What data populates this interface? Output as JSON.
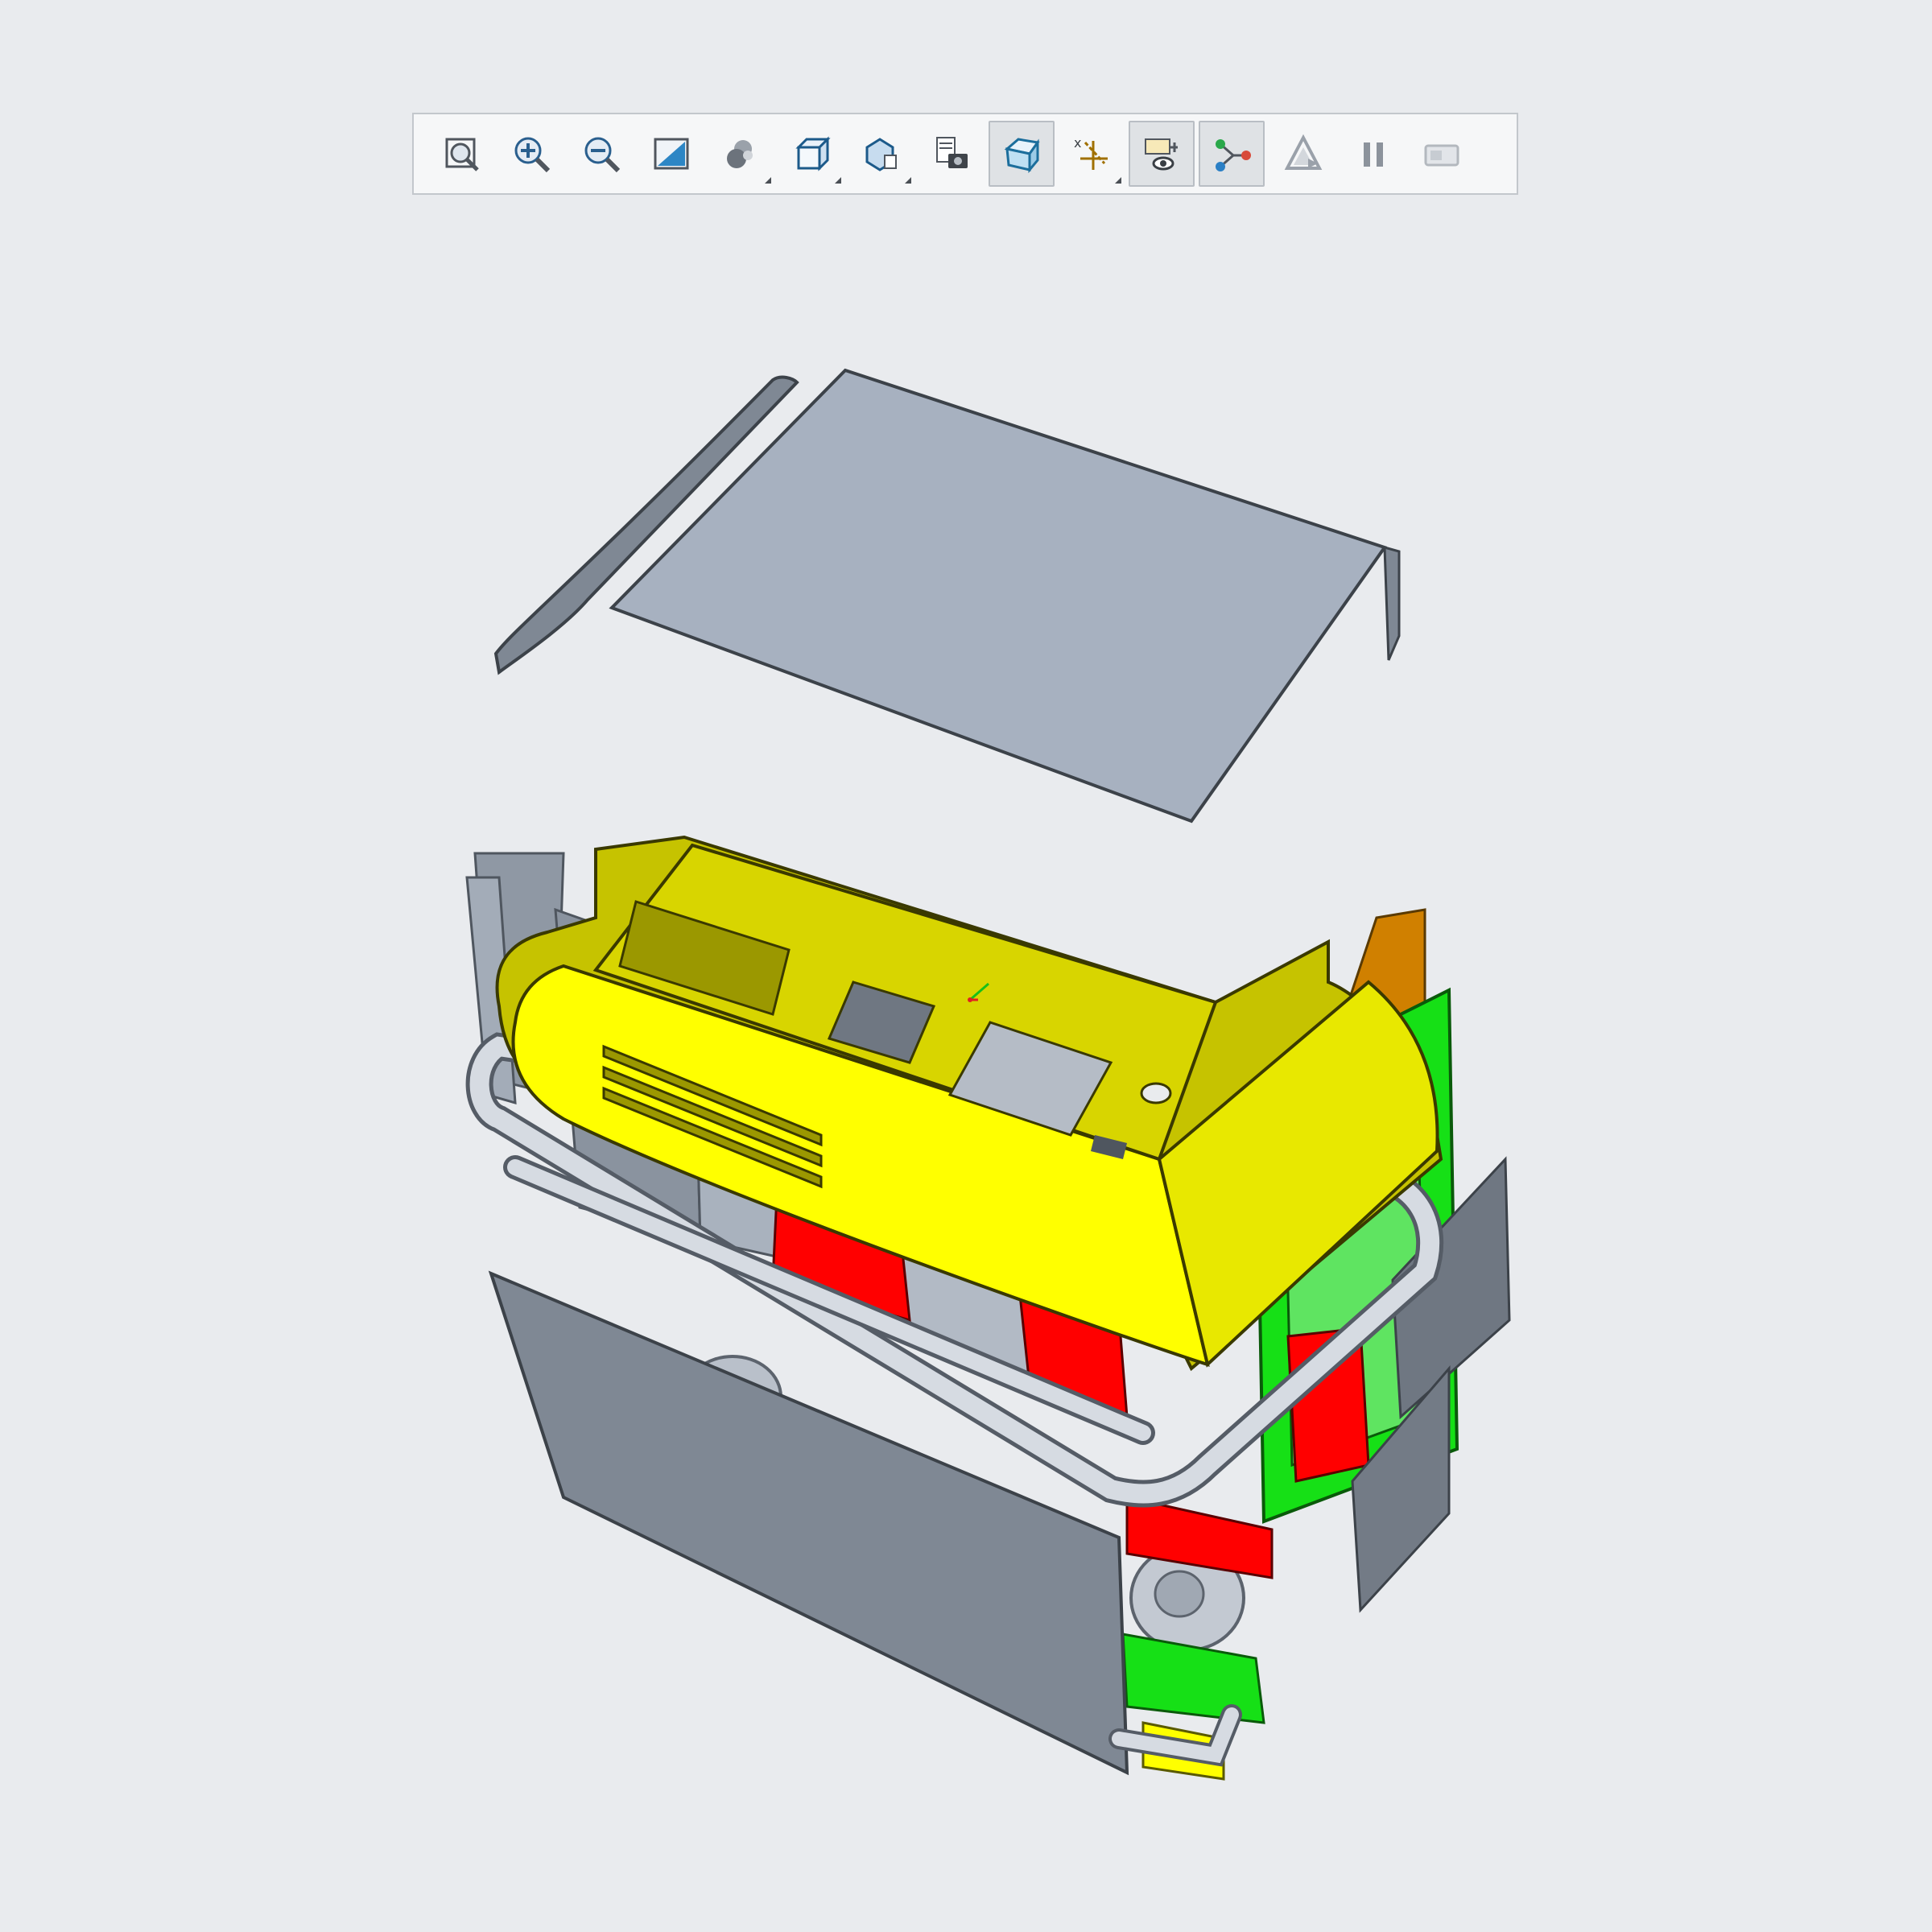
{
  "toolbar": {
    "buttons": [
      {
        "id": "refit",
        "icon": "refit-icon",
        "active": false,
        "flyout": false
      },
      {
        "id": "zoom-in",
        "icon": "zoom-in-icon",
        "active": false,
        "flyout": false
      },
      {
        "id": "zoom-out",
        "icon": "zoom-out-icon",
        "active": false,
        "flyout": false
      },
      {
        "id": "repaint",
        "icon": "repaint-icon",
        "active": false,
        "flyout": false
      },
      {
        "id": "display-style",
        "icon": "shaded-display-icon",
        "active": false,
        "flyout": true
      },
      {
        "id": "saved-orientations",
        "icon": "saved-orientations-icon",
        "active": false,
        "flyout": true
      },
      {
        "id": "view-manager",
        "icon": "view-manager-icon",
        "active": false,
        "flyout": true
      },
      {
        "id": "appearance-gallery",
        "icon": "camera-appearance-icon",
        "active": false,
        "flyout": false
      },
      {
        "id": "perspective",
        "icon": "perspective-view-icon",
        "active": true,
        "flyout": false
      },
      {
        "id": "datum-display",
        "icon": "datum-display-icon",
        "active": false,
        "flyout": true
      },
      {
        "id": "annotation-display",
        "icon": "annotation-display-icon",
        "active": true,
        "flyout": false
      },
      {
        "id": "spin-center",
        "icon": "spin-center-icon",
        "active": true,
        "flyout": false
      },
      {
        "id": "render",
        "icon": "render-icon",
        "active": false,
        "flyout": false
      },
      {
        "id": "pause",
        "icon": "pause-icon",
        "active": false,
        "flyout": false
      },
      {
        "id": "animation",
        "icon": "animation-icon",
        "active": false,
        "flyout": false
      }
    ]
  },
  "model": {
    "colors": {
      "background": "#e9ebee",
      "body_gray": "#7f8894",
      "panel_light": "#a7b1c0",
      "cover_yellow": "#ffff00",
      "cover_yellow_shade": "#c6c300",
      "frame_green": "#16e016",
      "interior_red": "#ff0000",
      "orange_part": "#d08000",
      "tube": "#d6dbe2"
    }
  }
}
